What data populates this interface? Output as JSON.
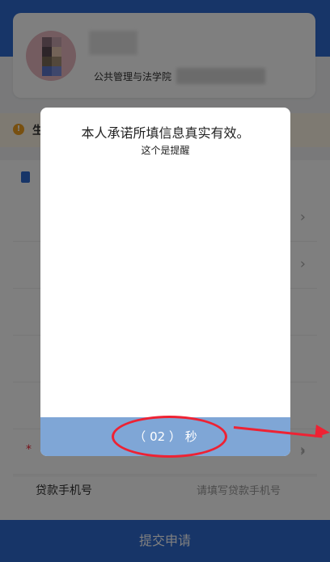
{
  "profile": {
    "school": "公共管理与法学院"
  },
  "notice": {
    "char": "生"
  },
  "form": {
    "loan_phone_label": "贷款手机号",
    "loan_phone_placeholder": "请填写贷款手机号"
  },
  "submit": {
    "label": "提交申请"
  },
  "modal": {
    "title": "本人承诺所填信息真实有效。",
    "subtitle": "这个是提醒",
    "countdown": "（ 02 ） 秒"
  },
  "colors": {
    "primary": "#2f6bd1",
    "annotation": "#e22233"
  }
}
